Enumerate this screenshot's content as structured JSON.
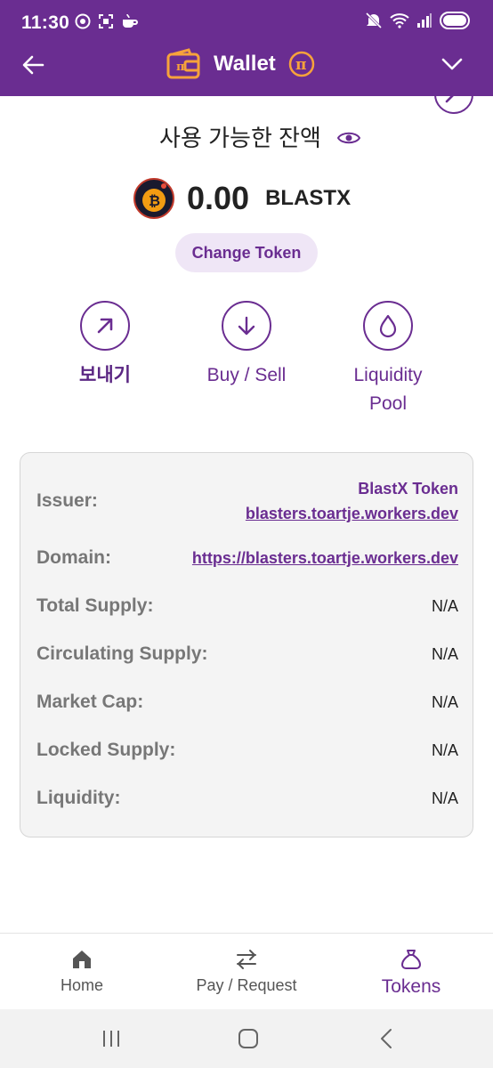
{
  "status_bar": {
    "time": "11:30",
    "icons_left": [
      "chrome-icon",
      "screenshot-icon",
      "coffee-icon"
    ],
    "icons_right": [
      "mute-icon",
      "wifi-icon",
      "signal-icon",
      "battery-icon"
    ]
  },
  "header": {
    "title": "Wallet",
    "icons": [
      "back-arrow-icon",
      "wallet-icon",
      "pi-logo-icon",
      "chevron-down-icon"
    ]
  },
  "balance": {
    "label": "사용 가능한 잔액",
    "amount": "0.00",
    "symbol": "BLASTX",
    "change_token_label": "Change Token"
  },
  "actions": [
    {
      "label": "보내기",
      "icon": "arrow-up-right-icon"
    },
    {
      "label": "Buy / Sell",
      "icon": "arrow-down-icon"
    },
    {
      "label_line1": "Liquidity",
      "label_line2": "Pool",
      "icon": "droplet-icon"
    }
  ],
  "token_info": {
    "issuer": {
      "label": "Issuer:",
      "name": "BlastX Token",
      "domain_link": "blasters.toartje.workers.dev"
    },
    "domain": {
      "label": "Domain:",
      "value": "https://blasters.toartje.workers.dev"
    },
    "total_supply": {
      "label": "Total Supply:",
      "value": "N/A"
    },
    "circulating_supply": {
      "label": "Circulating Supply:",
      "value": "N/A"
    },
    "market_cap": {
      "label": "Market Cap:",
      "value": "N/A"
    },
    "locked_supply": {
      "label": "Locked Supply:",
      "value": "N/A"
    },
    "liquidity": {
      "label": "Liquidity:",
      "value": "N/A"
    }
  },
  "bottom_nav": [
    {
      "label": "Home",
      "icon": "home-icon",
      "active": false
    },
    {
      "label": "Pay / Request",
      "icon": "swap-arrows-icon",
      "active": false
    },
    {
      "label": "Tokens",
      "icon": "money-bag-icon",
      "active": true
    }
  ],
  "colors": {
    "brand_purple": "#6a2d91",
    "accent_orange": "#f7a23b",
    "chip_bg": "#efe6f6",
    "card_bg": "#f4f4f4"
  }
}
